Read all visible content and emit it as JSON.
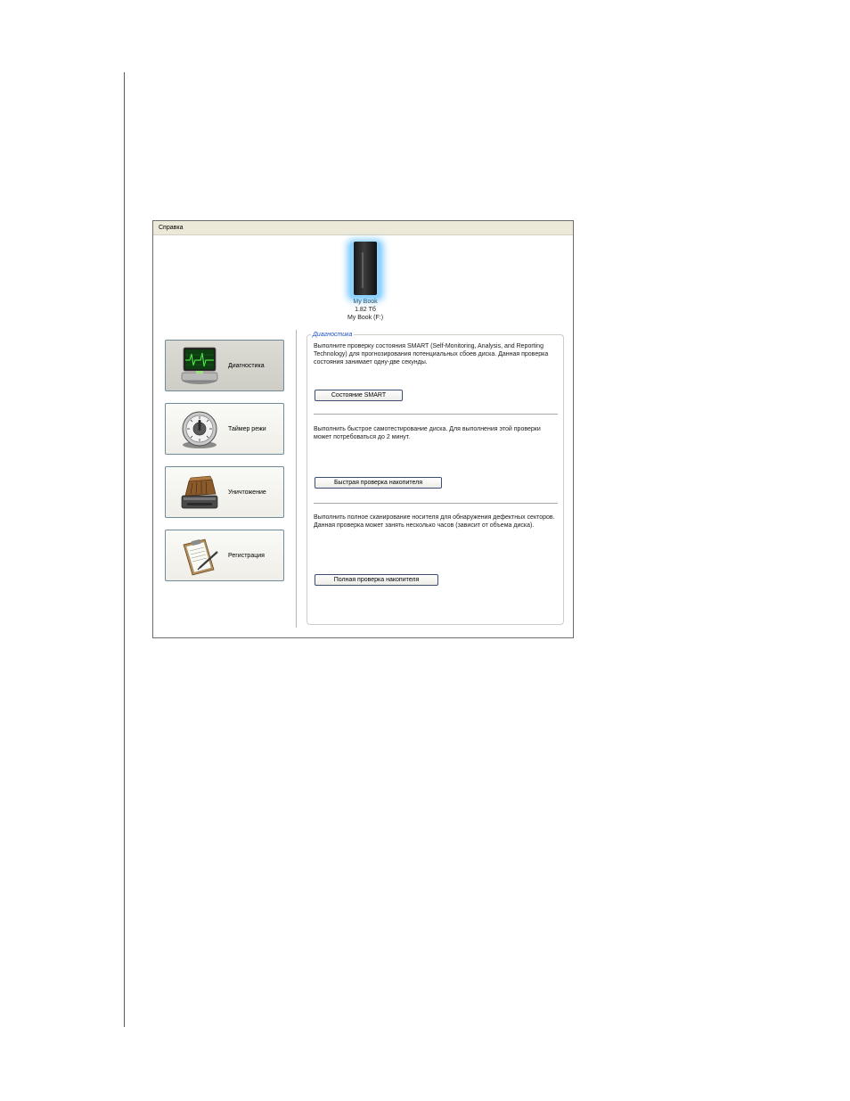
{
  "menubar": {
    "item": "Справка"
  },
  "device": {
    "name": "My Book",
    "capacity": "1.82 Тб",
    "volume": "My Book (F:)"
  },
  "nav": [
    {
      "label": "Диагностика",
      "icon": "diagnostics-monitor-icon",
      "active": true
    },
    {
      "label": "Таймер режи",
      "icon": "timer-dial-icon",
      "active": false
    },
    {
      "label": "Уничтожение",
      "icon": "shredder-drive-icon",
      "active": false
    },
    {
      "label": "Регистрация",
      "icon": "clipboard-pen-icon",
      "active": false
    }
  ],
  "diagnostics": {
    "title": "Диагностика",
    "sections": [
      {
        "description": "Выполните проверку состояния SMART (Self-Monitoring, Analysis, and Reporting Technology) для прогнозирования потенциальных сбоев диска. Данная проверка состояния занимает одну-две секунды.",
        "button": "Состояние SMART"
      },
      {
        "description": "Выполнить быстрое самотестирование диска. Для выполнения этой проверки может потребоваться до 2 минут.",
        "button": "Быстрая проверка накопителя"
      },
      {
        "description": "Выполнить полное сканирование носителя для обнаружения дефектных секторов. Данная проверка может занять несколько часов (зависит от объема диска).",
        "button": "Полная проверка накопителя"
      }
    ]
  }
}
